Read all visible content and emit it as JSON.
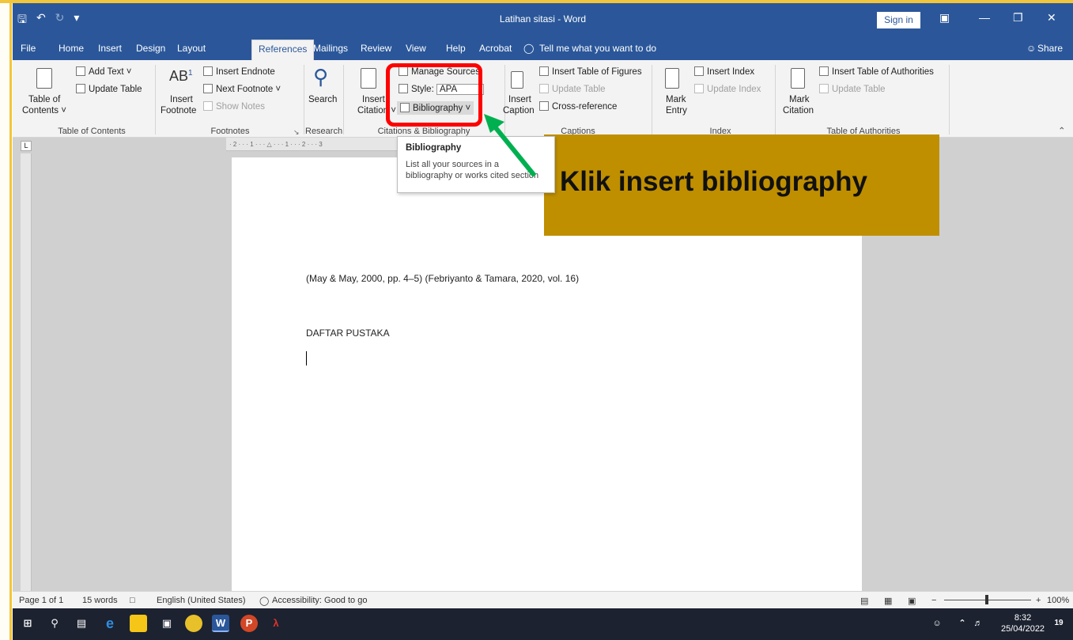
{
  "window": {
    "title": "Latihan sitasi  -  Word",
    "sign_in": "Sign in"
  },
  "tabs": [
    "File",
    "Home",
    "Insert",
    "Design",
    "Layout",
    "References",
    "Mailings",
    "Review",
    "View",
    "Help",
    "Acrobat"
  ],
  "active_tab": "References",
  "tell_me": "Tell me what you want to do",
  "share": "Share",
  "ribbon": {
    "toc": {
      "add_text": "Add Text",
      "update_table": "Update Table",
      "table_of_contents_l1": "Table of",
      "table_of_contents_l2": "Contents",
      "group": "Table of Contents"
    },
    "footnotes": {
      "insert_endnote": "Insert Endnote",
      "next_footnote": "Next Footnote",
      "show_notes": "Show Notes",
      "insert_footnote_l1": "Insert",
      "insert_footnote_l2": "Footnote",
      "group": "Footnotes"
    },
    "research": {
      "search": "Search",
      "group": "Research"
    },
    "citations": {
      "insert_citation_l1": "Insert",
      "insert_citation_l2": "Citation",
      "manage_sources": "Manage Sources",
      "style_label": "Style:",
      "style_value": "APA",
      "bibliography": "Bibliography",
      "group": "Citations & Bibliography"
    },
    "captions": {
      "insert_caption_l1": "Insert",
      "insert_caption_l2": "Caption",
      "insert_table_of_figures": "Insert Table of Figures",
      "update_table": "Update Table",
      "cross_reference": "Cross-reference",
      "group": "Captions"
    },
    "index": {
      "mark_entry_l1": "Mark",
      "mark_entry_l2": "Entry",
      "insert_index": "Insert Index",
      "update_index": "Update Index",
      "group": "Index"
    },
    "authorities": {
      "mark_citation_l1": "Mark",
      "mark_citation_l2": "Citation",
      "insert_table_of_authorities": "Insert Table of Authorities",
      "update_table": "Update Table",
      "group": "Table of Authorities"
    }
  },
  "tooltip": {
    "title": "Bibliography",
    "desc": "List all your sources in a\nbibliography or works cited section"
  },
  "annotation": {
    "callout": "Klik insert bibliography"
  },
  "document": {
    "citation_line": "(May & May, 2000, pp. 4–5) (Febriyanto & Tamara, 2020, vol. 16)",
    "heading": "DAFTAR PUSTAKA"
  },
  "status": {
    "page": "Page 1 of 1",
    "words": "15 words",
    "language": "English (United States)",
    "accessibility": "Accessibility: Good to go",
    "zoom": "100%"
  },
  "taskbar": {
    "time": "8:32",
    "date": "25/04/2022",
    "notifications": "19"
  },
  "colors": {
    "word_blue": "#2b579a",
    "highlight_red": "#ff0000",
    "callout_gold": "#bf8f00",
    "arrow_green": "#00b050"
  }
}
